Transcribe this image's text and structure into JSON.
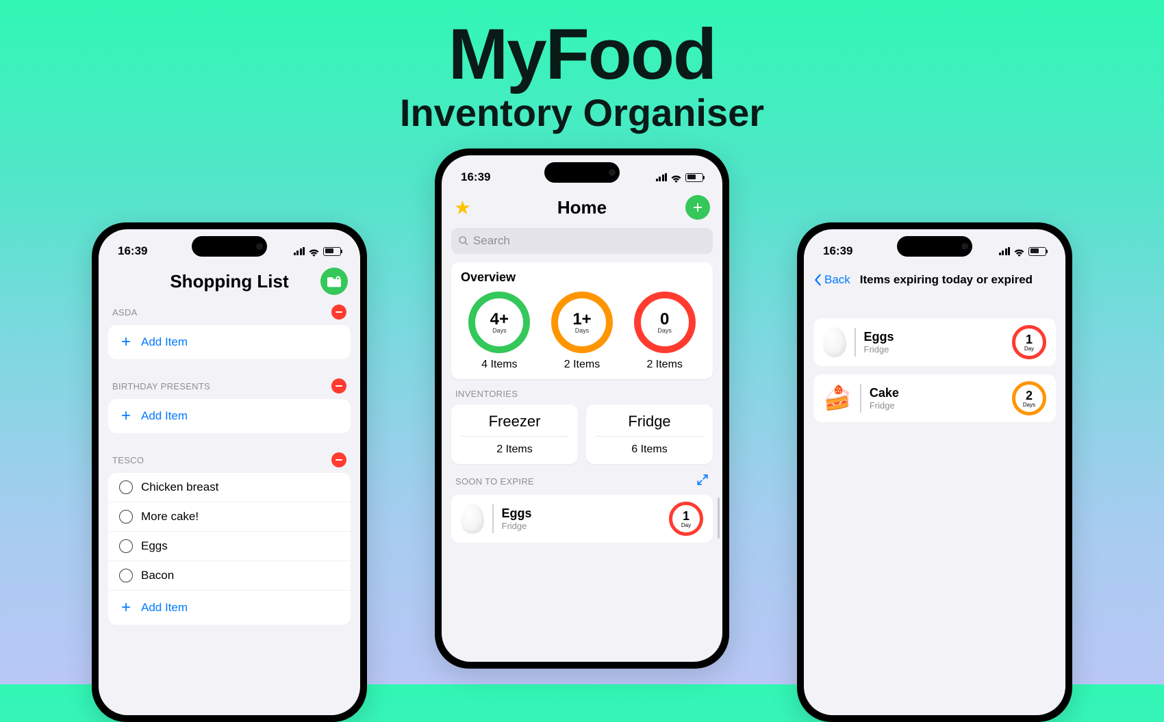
{
  "header": {
    "title": "MyFood",
    "subtitle": "Inventory Organiser"
  },
  "status_time": "16:39",
  "home": {
    "title": "Home",
    "search_placeholder": "Search",
    "overview_title": "Overview",
    "overview": [
      {
        "value": "4+",
        "unit": "Days",
        "caption": "4 Items",
        "color": "green"
      },
      {
        "value": "1+",
        "unit": "Days",
        "caption": "2 Items",
        "color": "orange"
      },
      {
        "value": "0",
        "unit": "Days",
        "caption": "2 Items",
        "color": "red"
      }
    ],
    "inventories_label": "INVENTORIES",
    "inventories": [
      {
        "name": "Freezer",
        "count": "2 Items"
      },
      {
        "name": "Fridge",
        "count": "6 Items"
      }
    ],
    "soon_label": "SOON TO EXPIRE",
    "soon_item": {
      "name": "Eggs",
      "location": "Fridge",
      "value": "1",
      "unit": "Day",
      "ring": "red",
      "icon": "egg"
    }
  },
  "shopping": {
    "title": "Shopping List",
    "add_item_label": "Add Item",
    "groups": [
      {
        "name": "ASDA",
        "items": []
      },
      {
        "name": "BIRTHDAY PRESENTS",
        "items": []
      },
      {
        "name": "TESCO",
        "items": [
          "Chicken breast",
          "More cake!",
          "Eggs",
          "Bacon"
        ]
      }
    ]
  },
  "expiring": {
    "back_label": "Back",
    "title": "Items expiring today or expired",
    "items": [
      {
        "name": "Eggs",
        "location": "Fridge",
        "value": "1",
        "unit": "Day",
        "ring": "red",
        "icon": "egg"
      },
      {
        "name": "Cake",
        "location": "Fridge",
        "value": "2",
        "unit": "Days",
        "ring": "orange",
        "icon": "cake"
      }
    ]
  }
}
